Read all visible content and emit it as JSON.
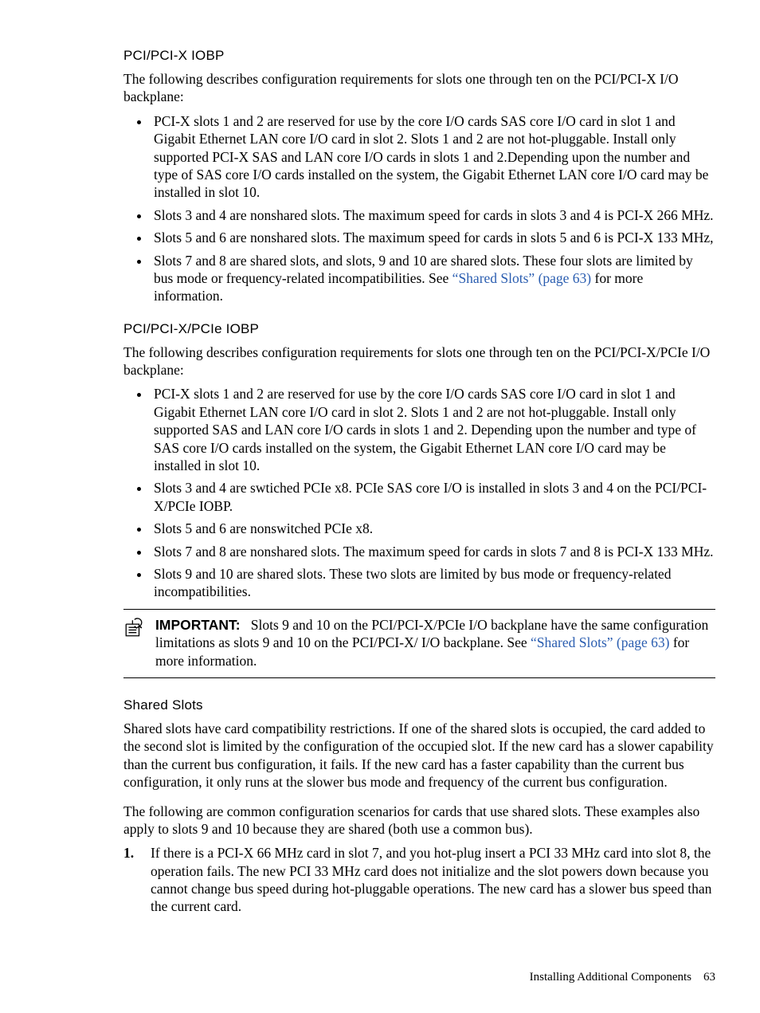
{
  "sec1": {
    "heading": "PCI/PCI-X IOBP",
    "intro": "The following describes configuration requirements for slots one through ten on the PCI/PCI-X I/O backplane:",
    "items": [
      "PCI-X slots 1 and 2 are reserved for use by the core I/O cards SAS core I/O card in slot 1 and Gigabit Ethernet LAN core I/O card in slot 2. Slots 1 and 2 are not hot-pluggable. Install only supported PCI-X SAS and LAN core I/O cards in slots 1 and 2.Depending upon the number and type of SAS core I/O cards installed on the system, the Gigabit Ethernet LAN core I/O card may be installed in slot 10.",
      "Slots 3 and 4 are nonshared slots. The maximum speed for cards in slots 3 and 4 is PCI-X 266 MHz.",
      "Slots 5 and 6 are nonshared slots. The maximum speed for cards in slots 5 and 6 is PCI-X 133 MHz,"
    ],
    "item4_pre": "Slots 7 and 8 are shared slots, and slots, 9 and 10 are shared slots. These four slots are limited by bus mode or frequency-related incompatibilities. See ",
    "item4_link": "“Shared Slots” (page 63)",
    "item4_post": " for more information."
  },
  "sec2": {
    "heading": "PCI/PCI-X/PCIe IOBP",
    "intro": "The following describes configuration requirements for slots one through ten on the PCI/PCI-X/PCIe I/O backplane:",
    "items": [
      "PCI-X slots 1 and 2 are reserved for use by the core I/O cards SAS core I/O card in slot 1 and Gigabit Ethernet LAN core I/O card in slot 2. Slots 1 and 2 are not hot-pluggable. Install only supported SAS and LAN core I/O cards in slots 1 and 2. Depending upon the number and type of SAS core I/O cards installed on the system, the Gigabit Ethernet LAN core I/O card may be installed in slot 10.",
      "Slots 3 and 4 are swtiched PCIe x8. PCIe SAS core I/O is installed in slots 3 and 4 on the PCI/PCI-X/PCIe IOBP.",
      "Slots 5 and 6 are nonswitched PCIe x8.",
      "Slots 7 and 8 are nonshared slots. The maximum speed for cards in slots 7 and 8 is PCI-X 133 MHz.",
      "Slots 9 and 10 are shared slots. These two slots are limited by bus mode or frequency-related incompatibilities."
    ]
  },
  "note": {
    "label": "IMPORTANT:",
    "text_pre": "Slots 9 and 10 on the PCI/PCI-X/PCIe I/O backplane have the same configuration limitations as slots 9 and 10 on the PCI/PCI-X/ I/O backplane. See ",
    "text_link": "“Shared Slots” (page 63)",
    "text_post": " for more information."
  },
  "sec3": {
    "heading": "Shared Slots",
    "p1": "Shared slots have card compatibility restrictions. If one of the shared slots is occupied, the card added to the second slot is limited by the configuration of the occupied slot. If the new card has a slower capability than the current bus configuration, it fails. If the new card has a faster capability than the current bus configuration, it only runs at the slower bus mode and frequency of the current bus configuration.",
    "p2": "The following are common configuration scenarios for cards that use shared slots. These examples also apply to slots 9 and 10 because they are shared (both use a common bus).",
    "ol1": "If there is a PCI-X 66 MHz card in slot 7, and you hot-plug insert a PCI 33 MHz card into slot 8, the operation fails. The new PCI 33 MHz card does not initialize and the slot powers down because you cannot change bus speed during hot-pluggable operations. The new card has a slower bus speed than the current card."
  },
  "footer": {
    "section": "Installing Additional Components",
    "page": "63"
  }
}
